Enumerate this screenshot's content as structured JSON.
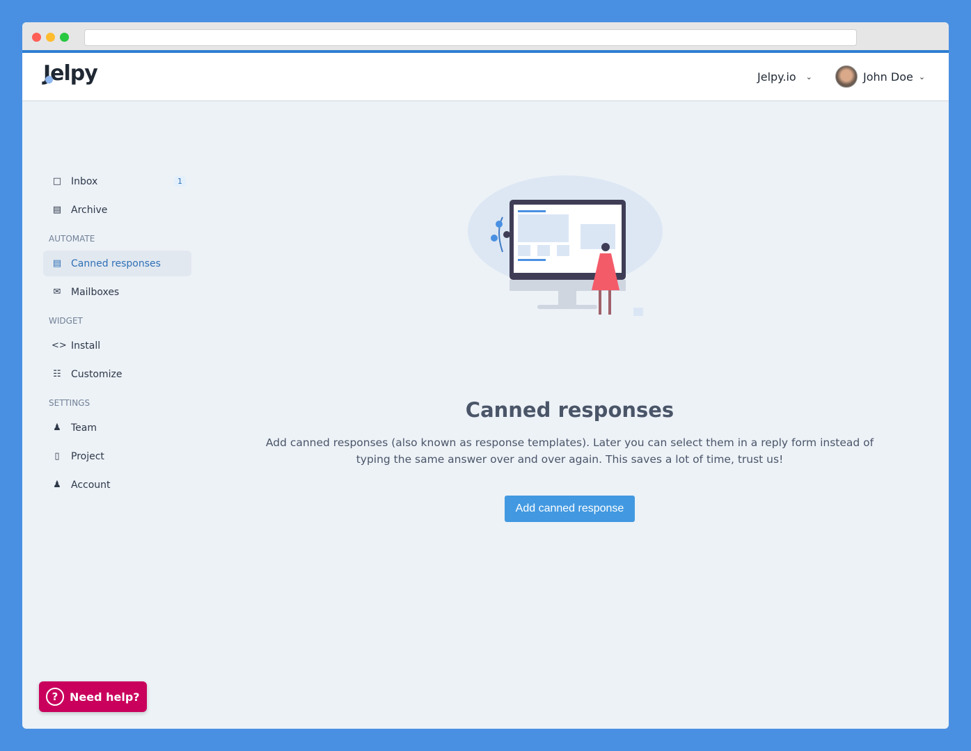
{
  "header": {
    "logo": "Jelpy",
    "project": "Jelpy.io",
    "user": "John Doe"
  },
  "sidebar": {
    "items": [
      {
        "label": "Inbox",
        "badge": "1"
      },
      {
        "label": "Archive"
      }
    ],
    "automate": {
      "title": "AUTOMATE",
      "items": [
        {
          "label": "Canned responses"
        },
        {
          "label": "Mailboxes"
        }
      ]
    },
    "widget": {
      "title": "WIDGET",
      "items": [
        {
          "label": "Install"
        },
        {
          "label": "Customize"
        }
      ]
    },
    "settings": {
      "title": "SETTINGS",
      "items": [
        {
          "label": "Team"
        },
        {
          "label": "Project"
        },
        {
          "label": "Account"
        }
      ]
    }
  },
  "main": {
    "title": "Canned responses",
    "description": "Add canned responses (also known as response templates). Later you can select them in a reply form instead of typing the same answer over and over again. This saves a lot of time, trust us!",
    "button": "Add canned response"
  },
  "help": {
    "label": "Need help?"
  },
  "colors": {
    "accent": "#4299e1",
    "help": "#c9005c",
    "active": "#2f6fb5"
  }
}
